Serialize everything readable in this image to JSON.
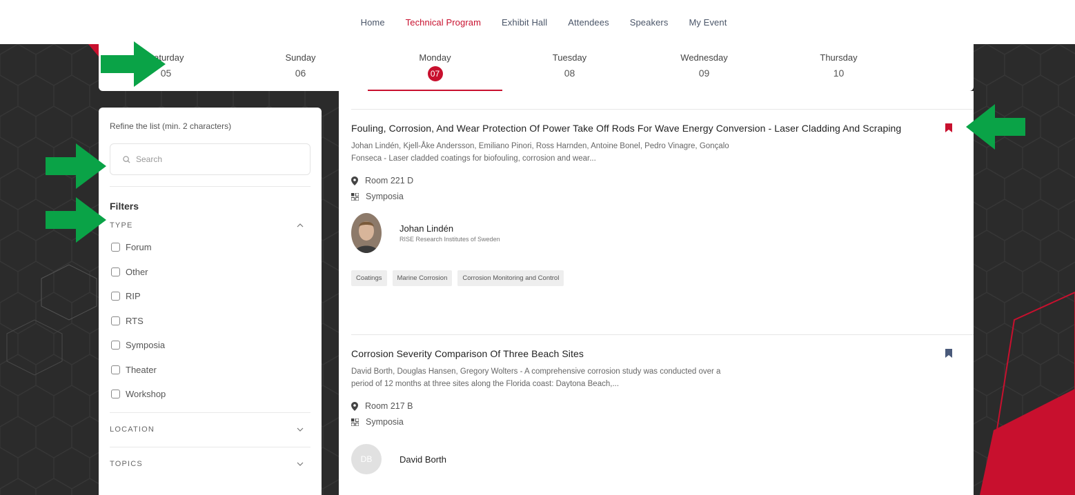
{
  "nav": {
    "items": [
      {
        "label": "Home",
        "active": false
      },
      {
        "label": "Technical Program",
        "active": true
      },
      {
        "label": "Exhibit Hall",
        "active": false
      },
      {
        "label": "Attendees",
        "active": false
      },
      {
        "label": "Speakers",
        "active": false
      },
      {
        "label": "My Event",
        "active": false
      }
    ]
  },
  "days": [
    {
      "name": "Saturday",
      "num": "05"
    },
    {
      "name": "Sunday",
      "num": "06"
    },
    {
      "name": "Monday",
      "num": "07",
      "active": true
    },
    {
      "name": "Tuesday",
      "num": "08"
    },
    {
      "name": "Wednesday",
      "num": "09"
    },
    {
      "name": "Thursday",
      "num": "10"
    }
  ],
  "sidebar": {
    "refine_label": "Refine the list (min. 2 characters)",
    "search_placeholder": "Search",
    "filters_title": "Filters",
    "type_section": "TYPE",
    "type_options": [
      "Forum",
      "Other",
      "RIP",
      "RTS",
      "Symposia",
      "Theater",
      "Workshop"
    ],
    "location_section": "LOCATION",
    "topics_section": "TOPICS"
  },
  "sessions": [
    {
      "title": "Fouling, Corrosion, And Wear Protection Of Power Take Off Rods For Wave Energy Conversion - Laser Cladding And Scraping",
      "description": "Johan Lindén, Kjell-Åke Andersson, Emiliano Pinori, Ross Harnden, Antoine Bonel, Pedro Vinagre, Gonçalo Fonseca - Laser cladded coatings for biofouling, corrosion and wear...",
      "room": "Room 221 D",
      "type": "Symposia",
      "bookmarked": true,
      "speaker": {
        "name": "Johan Lindén",
        "org": "RISE Research Institutes of Sweden"
      },
      "tags": [
        "Coatings",
        "Marine Corrosion",
        "Corrosion Monitoring and Control"
      ]
    },
    {
      "title": "Corrosion Severity Comparison Of Three Beach Sites",
      "description": "David Borth, Douglas Hansen, Gregory Wolters - A comprehensive corrosion study was conducted over a period of 12 months at three sites along the Florida coast: Daytona Beach,...",
      "room": "Room 217 B",
      "type": "Symposia",
      "bookmarked": false,
      "speaker": {
        "name": "David Borth",
        "initials": "DB"
      }
    }
  ],
  "colors": {
    "accent": "#c8102e",
    "arrow": "#0aa347",
    "background": "#2b2b2b",
    "bookmark_inactive": "#4a5a7a"
  }
}
